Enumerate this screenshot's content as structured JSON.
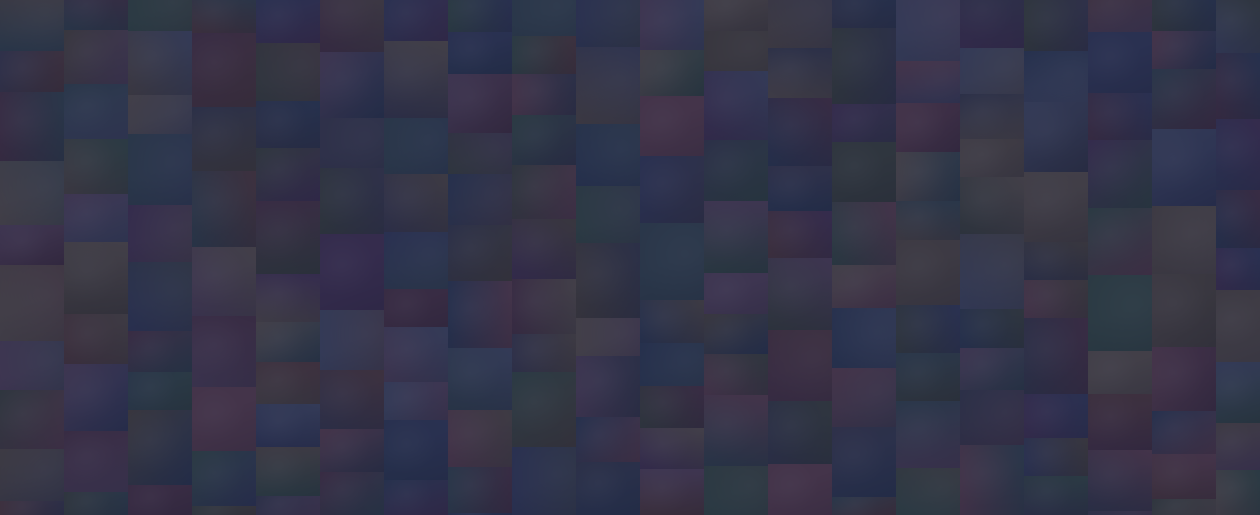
{
  "background": {
    "description_free": true,
    "overlay_color": "#1c1f3a",
    "palette": [
      "#4a5a86",
      "#7a4a5a",
      "#5c6b4a",
      "#8a7a5a",
      "#3e5a7a",
      "#6e4a7a",
      "#8a5a4a",
      "#4a6e6e",
      "#9a8a6a",
      "#5a5a6e",
      "#7a6e4a",
      "#4e7a5a",
      "#a0646e",
      "#6a7a9a",
      "#505868",
      "#8c6a86"
    ]
  }
}
